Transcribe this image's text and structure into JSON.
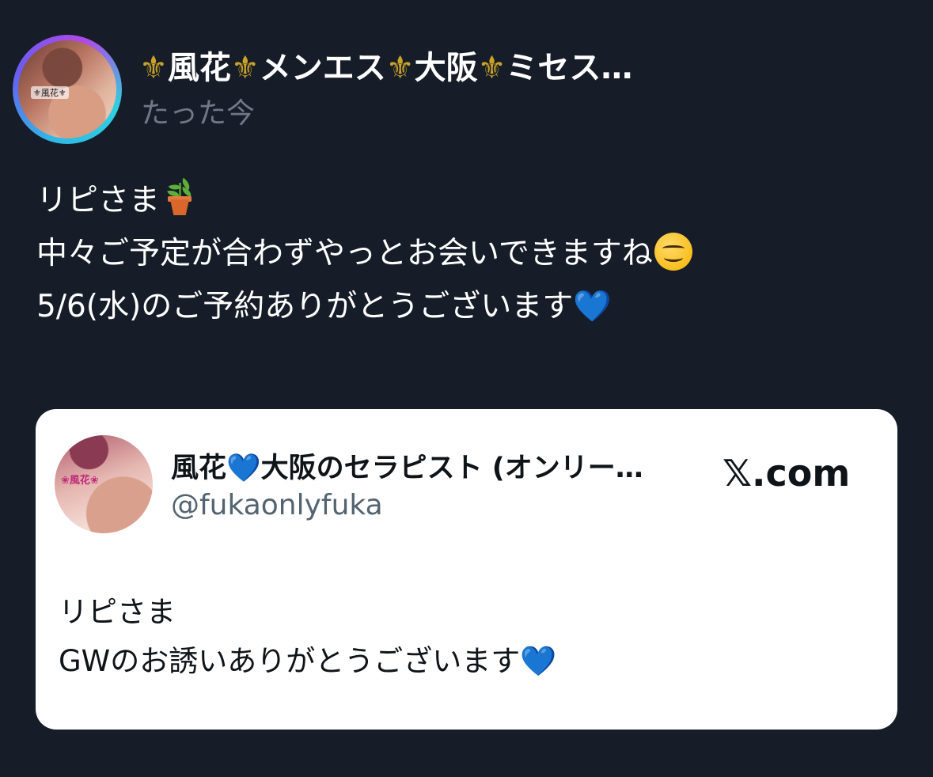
{
  "post": {
    "account_name_parts": [
      "⚜",
      "風花",
      "⚜",
      "メンエス",
      "⚜",
      "大阪",
      "⚜",
      "ミセス…"
    ],
    "timestamp": "たった今",
    "avatar_caption": "⚜風花⚜",
    "lines": [
      {
        "text": "リピさま",
        "emoji": "potted-plant-icon"
      },
      {
        "text": "中々ご予定が合わずやっとお会いできますね",
        "emoji": "smiling-face-icon"
      },
      {
        "text": "5/6(水)のご予約ありがとうございます",
        "emoji": "blue-heart-icon"
      }
    ]
  },
  "quoted_card": {
    "name_before": "風花",
    "name_after": "大阪のセラピスト (オンリー…",
    "handle": "@fukaonlyfuka",
    "source": "𝕏.com",
    "avatar_caption": "❀風花❀",
    "lines": [
      "リピさま",
      "GWのお誘いありがとうございます"
    ],
    "heart_glyph": "💙"
  },
  "colors": {
    "background": "#161d28",
    "card_background": "#ffffff",
    "muted_text": "#6f7884",
    "handle_text": "#536471",
    "blue_heart": "#1f82f0"
  }
}
